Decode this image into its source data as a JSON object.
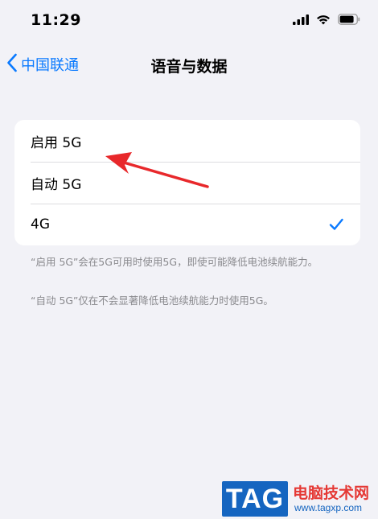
{
  "status_bar": {
    "time": "11:29"
  },
  "nav": {
    "back_label": "中国联通",
    "title": "语音与数据"
  },
  "options": [
    {
      "label": "启用 5G",
      "selected": false
    },
    {
      "label": "自动 5G",
      "selected": false
    },
    {
      "label": "4G",
      "selected": true
    }
  ],
  "footnotes": [
    "“启用 5G”会在5G可用时使用5G，即使可能降低电池续航能力。",
    "“自动 5G”仅在不会显著降低电池续航能力时使用5G。"
  ],
  "watermark": {
    "tag": "TAG",
    "site": "电脑技术网",
    "url": "www.tagxp.com"
  },
  "colors": {
    "accent": "#0a7aff",
    "annotation": "#e8282b",
    "background": "#f2f2f7"
  }
}
